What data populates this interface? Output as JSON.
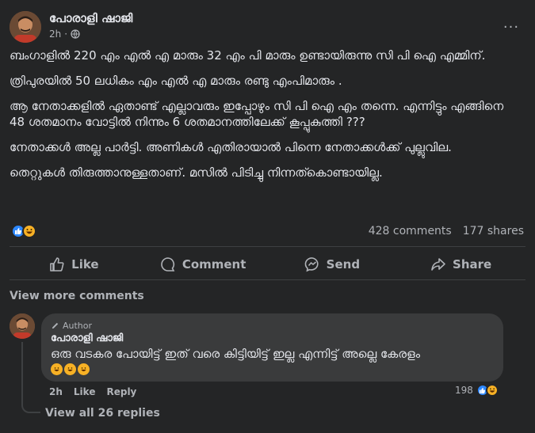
{
  "post": {
    "author": "പോരാളി ഷാജി",
    "time": "2h",
    "more_label": "···",
    "paragraphs": [
      "ബംഗാളിൽ  220 എം എൽ എ മാരും  32 എം പി മാരും ഉണ്ടായിരുന്നു സി പി ഐ എമ്മിന്.",
      "ത്രിപുരയിൽ  50 ലധികം എം എൽ എ മാരും രണ്ടു എംപിമാരും .",
      "ആ നേതാക്കളിൽ ഏതാണ്ട് എല്ലാവരും ഇപ്പോഴും സി പി ഐ എം തന്നെ. എന്നിട്ടും എങ്ങിനെ  48 ശതമാനം വോട്ടിൽ നിന്നും 6 ശതമാനത്തിലേക്ക് കൂപ്പുകുത്തി ???",
      "നേതാക്കൾ അല്ല പാർട്ടി.  അണികൾ എതിരായാൽ പിന്നെ നേതാക്കൾക്ക് പുല്ലുവില.",
      "തെറ്റുകൾ തിരുത്താനുള്ളതാണ്.  മസിൽ പിടിച്ചു നിന്നത്കൊണ്ടായില്ല."
    ],
    "reactions": [
      "like",
      "haha"
    ],
    "comments_count": "428 comments",
    "shares_count": "177 shares"
  },
  "actions": {
    "like": "Like",
    "comment": "Comment",
    "send": "Send",
    "share": "Share"
  },
  "comments_section": {
    "view_more": "View more comments",
    "comment": {
      "author_tag": "Author",
      "author": "പോരാളി ഷാജി",
      "text": "ഒരു വടകര പോയിട്ട് ഇത് വരെ കിട്ടിയിട്ട് ഇല്ല എന്നിട്ട് അല്ലെ കേരളം",
      "emojis": [
        "haha",
        "haha",
        "haha"
      ],
      "time": "2h",
      "like_label": "Like",
      "reply_label": "Reply",
      "reaction_count": "198",
      "reactions": [
        "like",
        "haha"
      ]
    },
    "view_replies": "View all 26 replies"
  },
  "colors": {
    "background": "#242526",
    "bubble": "#3a3b3c",
    "text_primary": "#e4e6eb",
    "text_secondary": "#b0b3b8",
    "like_blue": "#2d88ff",
    "haha_yellow": "#f7b125"
  }
}
